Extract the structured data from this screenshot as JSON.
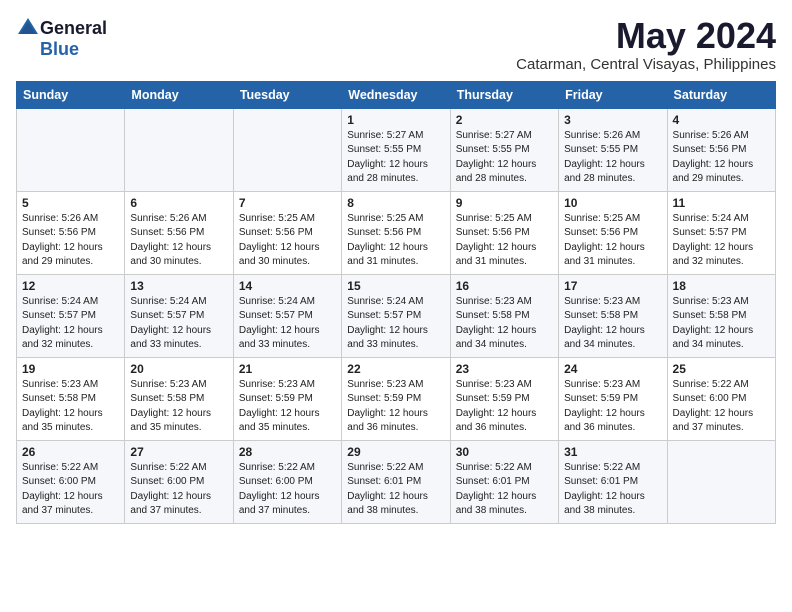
{
  "logo": {
    "text_general": "General",
    "text_blue": "Blue",
    "line2": ""
  },
  "header": {
    "month": "May 2024",
    "location": "Catarman, Central Visayas, Philippines"
  },
  "weekdays": [
    "Sunday",
    "Monday",
    "Tuesday",
    "Wednesday",
    "Thursday",
    "Friday",
    "Saturday"
  ],
  "weeks": [
    [
      {
        "day": "",
        "info": ""
      },
      {
        "day": "",
        "info": ""
      },
      {
        "day": "",
        "info": ""
      },
      {
        "day": "1",
        "info": "Sunrise: 5:27 AM\nSunset: 5:55 PM\nDaylight: 12 hours\nand 28 minutes."
      },
      {
        "day": "2",
        "info": "Sunrise: 5:27 AM\nSunset: 5:55 PM\nDaylight: 12 hours\nand 28 minutes."
      },
      {
        "day": "3",
        "info": "Sunrise: 5:26 AM\nSunset: 5:55 PM\nDaylight: 12 hours\nand 28 minutes."
      },
      {
        "day": "4",
        "info": "Sunrise: 5:26 AM\nSunset: 5:56 PM\nDaylight: 12 hours\nand 29 minutes."
      }
    ],
    [
      {
        "day": "5",
        "info": "Sunrise: 5:26 AM\nSunset: 5:56 PM\nDaylight: 12 hours\nand 29 minutes."
      },
      {
        "day": "6",
        "info": "Sunrise: 5:26 AM\nSunset: 5:56 PM\nDaylight: 12 hours\nand 30 minutes."
      },
      {
        "day": "7",
        "info": "Sunrise: 5:25 AM\nSunset: 5:56 PM\nDaylight: 12 hours\nand 30 minutes."
      },
      {
        "day": "8",
        "info": "Sunrise: 5:25 AM\nSunset: 5:56 PM\nDaylight: 12 hours\nand 31 minutes."
      },
      {
        "day": "9",
        "info": "Sunrise: 5:25 AM\nSunset: 5:56 PM\nDaylight: 12 hours\nand 31 minutes."
      },
      {
        "day": "10",
        "info": "Sunrise: 5:25 AM\nSunset: 5:56 PM\nDaylight: 12 hours\nand 31 minutes."
      },
      {
        "day": "11",
        "info": "Sunrise: 5:24 AM\nSunset: 5:57 PM\nDaylight: 12 hours\nand 32 minutes."
      }
    ],
    [
      {
        "day": "12",
        "info": "Sunrise: 5:24 AM\nSunset: 5:57 PM\nDaylight: 12 hours\nand 32 minutes."
      },
      {
        "day": "13",
        "info": "Sunrise: 5:24 AM\nSunset: 5:57 PM\nDaylight: 12 hours\nand 33 minutes."
      },
      {
        "day": "14",
        "info": "Sunrise: 5:24 AM\nSunset: 5:57 PM\nDaylight: 12 hours\nand 33 minutes."
      },
      {
        "day": "15",
        "info": "Sunrise: 5:24 AM\nSunset: 5:57 PM\nDaylight: 12 hours\nand 33 minutes."
      },
      {
        "day": "16",
        "info": "Sunrise: 5:23 AM\nSunset: 5:58 PM\nDaylight: 12 hours\nand 34 minutes."
      },
      {
        "day": "17",
        "info": "Sunrise: 5:23 AM\nSunset: 5:58 PM\nDaylight: 12 hours\nand 34 minutes."
      },
      {
        "day": "18",
        "info": "Sunrise: 5:23 AM\nSunset: 5:58 PM\nDaylight: 12 hours\nand 34 minutes."
      }
    ],
    [
      {
        "day": "19",
        "info": "Sunrise: 5:23 AM\nSunset: 5:58 PM\nDaylight: 12 hours\nand 35 minutes."
      },
      {
        "day": "20",
        "info": "Sunrise: 5:23 AM\nSunset: 5:58 PM\nDaylight: 12 hours\nand 35 minutes."
      },
      {
        "day": "21",
        "info": "Sunrise: 5:23 AM\nSunset: 5:59 PM\nDaylight: 12 hours\nand 35 minutes."
      },
      {
        "day": "22",
        "info": "Sunrise: 5:23 AM\nSunset: 5:59 PM\nDaylight: 12 hours\nand 36 minutes."
      },
      {
        "day": "23",
        "info": "Sunrise: 5:23 AM\nSunset: 5:59 PM\nDaylight: 12 hours\nand 36 minutes."
      },
      {
        "day": "24",
        "info": "Sunrise: 5:23 AM\nSunset: 5:59 PM\nDaylight: 12 hours\nand 36 minutes."
      },
      {
        "day": "25",
        "info": "Sunrise: 5:22 AM\nSunset: 6:00 PM\nDaylight: 12 hours\nand 37 minutes."
      }
    ],
    [
      {
        "day": "26",
        "info": "Sunrise: 5:22 AM\nSunset: 6:00 PM\nDaylight: 12 hours\nand 37 minutes."
      },
      {
        "day": "27",
        "info": "Sunrise: 5:22 AM\nSunset: 6:00 PM\nDaylight: 12 hours\nand 37 minutes."
      },
      {
        "day": "28",
        "info": "Sunrise: 5:22 AM\nSunset: 6:00 PM\nDaylight: 12 hours\nand 37 minutes."
      },
      {
        "day": "29",
        "info": "Sunrise: 5:22 AM\nSunset: 6:01 PM\nDaylight: 12 hours\nand 38 minutes."
      },
      {
        "day": "30",
        "info": "Sunrise: 5:22 AM\nSunset: 6:01 PM\nDaylight: 12 hours\nand 38 minutes."
      },
      {
        "day": "31",
        "info": "Sunrise: 5:22 AM\nSunset: 6:01 PM\nDaylight: 12 hours\nand 38 minutes."
      },
      {
        "day": "",
        "info": ""
      }
    ]
  ]
}
